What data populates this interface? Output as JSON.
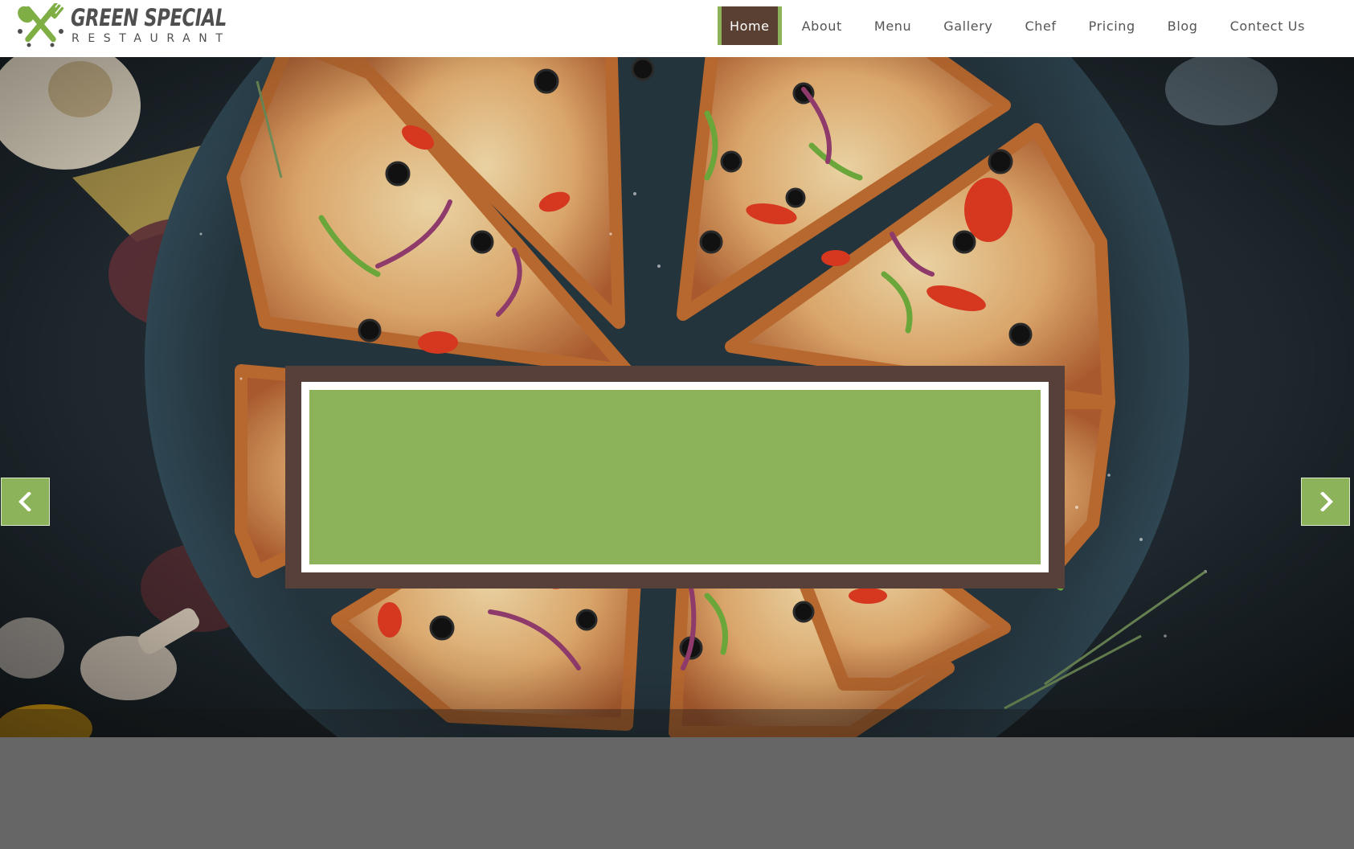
{
  "brand": {
    "name": "GREEN SPECIAL",
    "tagline": "RESTAURANT"
  },
  "nav": {
    "items": [
      {
        "label": "Home",
        "active": true
      },
      {
        "label": "About",
        "active": false
      },
      {
        "label": "Menu",
        "active": false
      },
      {
        "label": "Gallery",
        "active": false
      },
      {
        "label": "Chef",
        "active": false
      },
      {
        "label": "Pricing",
        "active": false
      },
      {
        "label": "Blog",
        "active": false
      },
      {
        "label": "Contect Us",
        "active": false
      }
    ]
  },
  "hero": {
    "image": "pizza-overhead-photo",
    "prev_icon": "chevron-left-icon",
    "next_icon": "chevron-right-icon"
  },
  "colors": {
    "accent_green": "#8db35a",
    "accent_brown": "#5a4033",
    "frame_brown": "#57403a",
    "lower_band": "#666666"
  }
}
